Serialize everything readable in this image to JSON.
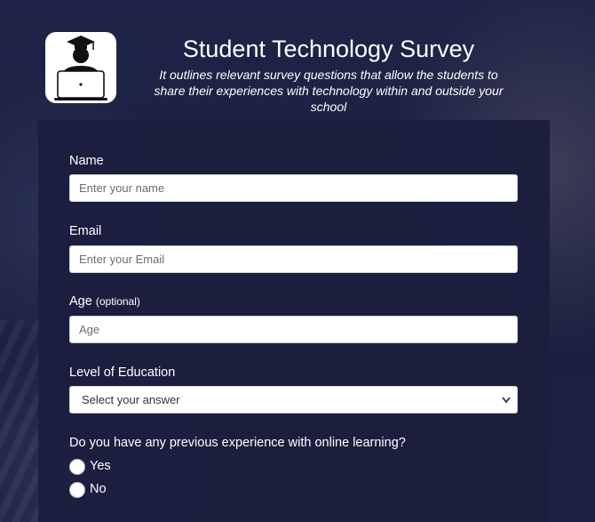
{
  "header": {
    "title": "Student Technology Survey",
    "subtitle": "It outlines relevant survey questions that allow the students to share their experiences with technology within and outside your school",
    "logo_icon": "student-graduate-laptop-icon"
  },
  "form": {
    "name": {
      "label": "Name",
      "placeholder": "Enter your name",
      "value": ""
    },
    "email": {
      "label": "Email",
      "placeholder": "Enter your Email",
      "value": ""
    },
    "age": {
      "label": "Age",
      "optional_note": "(optional)",
      "placeholder": "Age",
      "value": ""
    },
    "education": {
      "label": "Level of Education",
      "selected": "Select your answer"
    },
    "online_learning": {
      "question": "Do you have any previous experience with online learning?",
      "options": [
        "Yes",
        "No"
      ]
    }
  },
  "colors": {
    "background": "#1d2344",
    "panel": "#1c1e3e",
    "text": "#ffffff",
    "input_bg": "#ffffff"
  }
}
